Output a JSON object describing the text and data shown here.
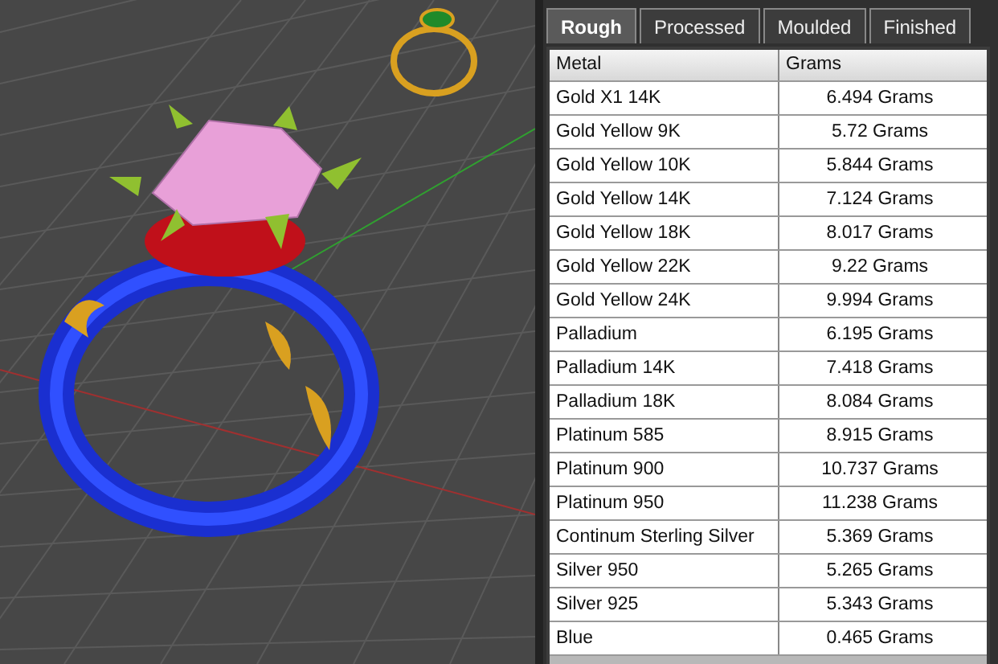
{
  "tabs": [
    {
      "label": "Rough",
      "selected": true
    },
    {
      "label": "Processed",
      "selected": false
    },
    {
      "label": "Moulded",
      "selected": false
    },
    {
      "label": "Finished",
      "selected": false
    }
  ],
  "table": {
    "columns": [
      "Metal",
      "Grams"
    ],
    "rows": [
      [
        "Gold X1 14K",
        "6.494 Grams"
      ],
      [
        "Gold Yellow 9K",
        "5.72 Grams"
      ],
      [
        "Gold Yellow 10K",
        "5.844 Grams"
      ],
      [
        "Gold Yellow 14K",
        "7.124 Grams"
      ],
      [
        "Gold Yellow 18K",
        "8.017 Grams"
      ],
      [
        "Gold Yellow 22K",
        "9.22 Grams"
      ],
      [
        "Gold Yellow 24K",
        "9.994 Grams"
      ],
      [
        "Palladium",
        "6.195 Grams"
      ],
      [
        "Palladium 14K",
        "7.418 Grams"
      ],
      [
        "Palladium 18K",
        "8.084 Grams"
      ],
      [
        "Platinum 585",
        "8.915 Grams"
      ],
      [
        "Platinum 900",
        "10.737 Grams"
      ],
      [
        "Platinum 950",
        "11.238 Grams"
      ],
      [
        "Continum Sterling Silver",
        "5.369 Grams"
      ],
      [
        "Silver 950",
        "5.265 Grams"
      ],
      [
        "Silver 925",
        "5.343 Grams"
      ],
      [
        "Blue",
        "0.465 Grams"
      ]
    ]
  }
}
